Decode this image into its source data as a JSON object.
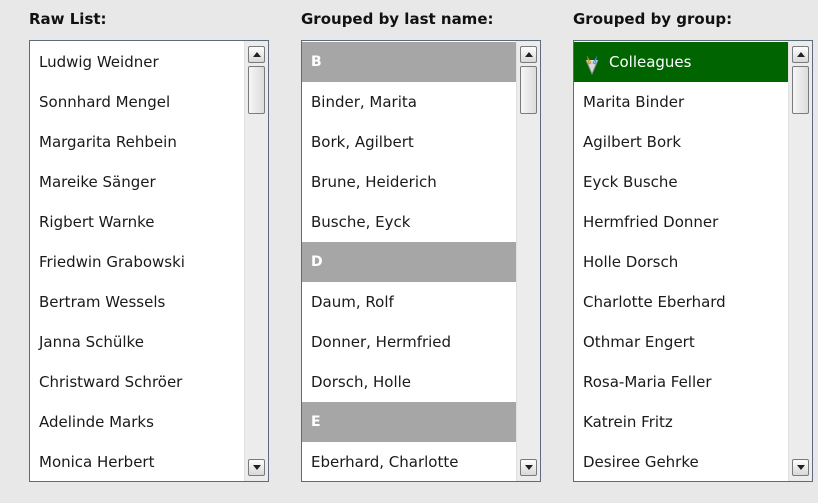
{
  "panels": [
    {
      "title": "Raw List:",
      "rows": [
        {
          "type": "item",
          "text": "Ludwig Weidner"
        },
        {
          "type": "item",
          "text": "Sonnhard Mengel"
        },
        {
          "type": "item",
          "text": "Margarita Rehbein"
        },
        {
          "type": "item",
          "text": "Mareike Sänger"
        },
        {
          "type": "item",
          "text": "Rigbert Warnke"
        },
        {
          "type": "item",
          "text": "Friedwin Grabowski"
        },
        {
          "type": "item",
          "text": "Bertram Wessels"
        },
        {
          "type": "item",
          "text": "Janna Schülke"
        },
        {
          "type": "item",
          "text": "Christward Schröer"
        },
        {
          "type": "item",
          "text": "Adelinde Marks"
        },
        {
          "type": "item",
          "text": "Monica Herbert"
        }
      ]
    },
    {
      "title": "Grouped by last name:",
      "rows": [
        {
          "type": "header",
          "text": "B"
        },
        {
          "type": "item",
          "text": "Binder, Marita"
        },
        {
          "type": "item",
          "text": "Bork, Agilbert"
        },
        {
          "type": "item",
          "text": "Brune, Heiderich"
        },
        {
          "type": "item",
          "text": "Busche, Eyck"
        },
        {
          "type": "header",
          "text": "D"
        },
        {
          "type": "item",
          "text": "Daum, Rolf"
        },
        {
          "type": "item",
          "text": "Donner, Hermfried"
        },
        {
          "type": "item",
          "text": "Dorsch, Holle"
        },
        {
          "type": "header",
          "text": "E"
        },
        {
          "type": "item",
          "text": "Eberhard, Charlotte"
        }
      ]
    },
    {
      "title": "Grouped by group:",
      "rows": [
        {
          "type": "header-selected",
          "text": "Colleagues",
          "icon": "tag-icon"
        },
        {
          "type": "item",
          "text": "Marita Binder"
        },
        {
          "type": "item",
          "text": "Agilbert Bork"
        },
        {
          "type": "item",
          "text": "Eyck Busche"
        },
        {
          "type": "item",
          "text": "Hermfried Donner"
        },
        {
          "type": "item",
          "text": "Holle Dorsch"
        },
        {
          "type": "item",
          "text": "Charlotte Eberhard"
        },
        {
          "type": "item",
          "text": "Othmar Engert"
        },
        {
          "type": "item",
          "text": "Rosa-Maria Feller"
        },
        {
          "type": "item",
          "text": "Katrein Fritz"
        },
        {
          "type": "item",
          "text": "Desiree Gehrke"
        }
      ]
    }
  ],
  "colors": {
    "group_header": "#a6a6a6",
    "selected_group": "#006400",
    "background": "#e8e8e8"
  }
}
